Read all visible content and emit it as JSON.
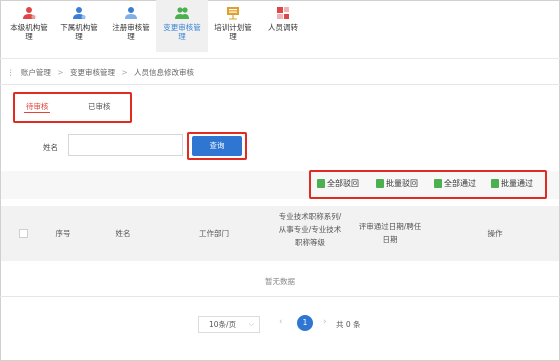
{
  "nav": {
    "items": [
      {
        "label": "本级机构管\n理",
        "icon": "user-icon",
        "color": "#e04646"
      },
      {
        "label": "下属机构管\n理",
        "icon": "user-icon",
        "color": "#3a7fd5"
      },
      {
        "label": "注册审核管\n理",
        "icon": "users-icon",
        "color": "#3a7fd5"
      },
      {
        "label": "变更审核管\n理",
        "icon": "users-icon",
        "color": "#4caf50"
      },
      {
        "label": "培训计划管\n理",
        "icon": "presentation-icon",
        "color": "#e0a030"
      },
      {
        "label": "人员调转",
        "icon": "transfer-icon",
        "color": "#e04646"
      }
    ]
  },
  "breadcrumb": {
    "menu_icon": "menu-icon",
    "items": [
      "账户管理",
      ">",
      "变更审核管理",
      ">",
      "人员信息修改审核"
    ]
  },
  "tabs": [
    {
      "label": "待审核",
      "active": true
    },
    {
      "label": "已审核",
      "active": false
    }
  ],
  "search": {
    "label": "姓名",
    "value": "",
    "button": "查询"
  },
  "actions": [
    {
      "label": "全部驳回",
      "color": "#4caf50"
    },
    {
      "label": "批量驳回",
      "color": "#4caf50"
    },
    {
      "label": "全部通过",
      "color": "#4caf50"
    },
    {
      "label": "批量通过",
      "color": "#4caf50"
    }
  ],
  "table": {
    "columns": [
      "序号",
      "姓名",
      "工作部门",
      "专业技术职称系列/\n从事专业/专业技术\n职称等级",
      "评审通过日期/聘任\n日期",
      "操作"
    ],
    "empty_text": "暂无数据"
  },
  "pagination": {
    "page_size": "10条/页",
    "current_page": "1",
    "total": "共 0 条"
  },
  "colors": {
    "accent": "#2f76d2",
    "highlight": "#e02a22"
  }
}
